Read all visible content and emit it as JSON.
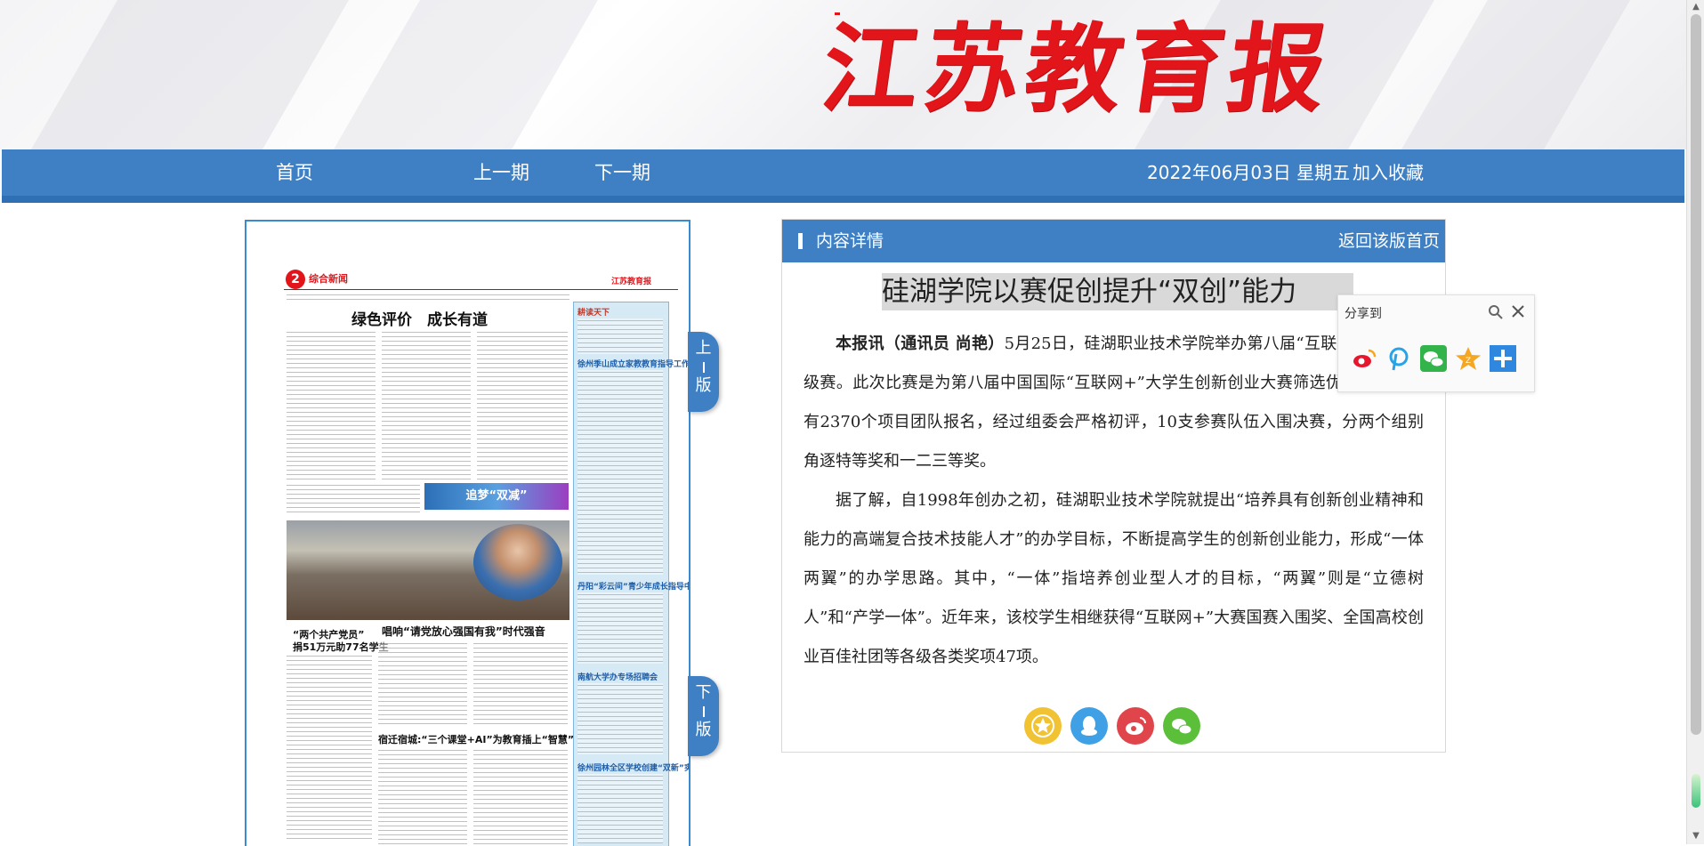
{
  "header": {
    "masthead": "江苏教育报"
  },
  "nav": {
    "home": "首页",
    "prev_issue": "上一期",
    "next_issue": "下一期",
    "date": "2022年06月03日 星期五",
    "bookmark": "加入收藏"
  },
  "paper": {
    "page_no": "2",
    "section": "综合新闻",
    "logo": "江苏教育报",
    "headline": "绿色评价　成长有道",
    "banner": "追梦“双减”",
    "sub1": "唱响“请党放心强国有我”时代强音",
    "sub2": "宿迁宿城:“三个课堂+AI”为教育插上“智慧”翅膀",
    "sub3": "“两个共产党员”",
    "sub3b": "捐51万元助77名学生",
    "side_titles": [
      "耕读天下",
      "徐州季山成立家教教育指导工作站",
      "丹阳“彩云间”青少年成长指导中心揭牌",
      "南航大学办专场招聘会",
      "徐州园林全区学校创建“双新”实验"
    ]
  },
  "side_tabs": {
    "prev_page": [
      "上",
      "版"
    ],
    "next_page": [
      "下",
      "版"
    ]
  },
  "panel": {
    "heading": "内容详情",
    "back_link": "返回该版首页",
    "article_title": "硅湖学院以赛促创提升“双创”能力",
    "lead": "本报讯（通讯员 尚艳）",
    "para1": "5月25日，硅湖职业技术学院举办第八届“互联网+”线上校级赛。此次比赛是为第八届中国国际“互联网+”大学生创新创业大赛筛选优质项目，共有2370个项目团队报名，经过组委会严格初评，10支参赛队伍入围决赛，分两个组别角逐特等奖和一二三等奖。",
    "para2": "据了解，自1998年创办之初，硅湖职业技术学院就提出“培养具有创新创业精神和能力的高端复合技术技能人才”的办学目标，不断提高学生的创新创业能力，形成“一体两翼”的办学思路。其中，“一体”指培养创业型人才的目标，“两翼”则是“立德树人”和“产学一体”。近年来，该校学生相继获得“互联网+”大赛国赛入围奖、全国高校创业百佳社团等各级各类奖项47项。",
    "share_buttons": [
      "star-icon",
      "qq-icon",
      "weibo-icon",
      "wechat-icon"
    ]
  },
  "share_popup": {
    "title": "分享到",
    "icons": [
      "weibo-icon",
      "pinterest-icon",
      "wechat-icon",
      "qzone-icon",
      "more-icon"
    ]
  },
  "colors": {
    "brand_blue": "#3f80c5",
    "masthead_red": "#e2151b",
    "title_highlight": "#d9d9d9"
  }
}
